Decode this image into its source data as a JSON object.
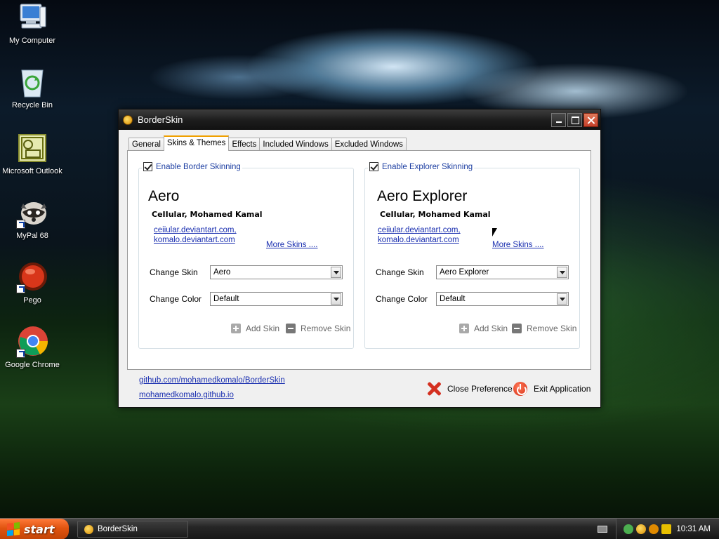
{
  "desktop": {
    "icons": [
      {
        "label": "My Computer"
      },
      {
        "label": "Recycle Bin"
      },
      {
        "label": "Microsoft Outlook"
      },
      {
        "label": "MyPal 68"
      },
      {
        "label": "Pego"
      },
      {
        "label": "Google Chrome"
      }
    ]
  },
  "window": {
    "title": "BorderSkin",
    "tabs": [
      {
        "label": "General",
        "active": false
      },
      {
        "label": "Skins & Themes",
        "active": true
      },
      {
        "label": "Effects",
        "active": false
      },
      {
        "label": "Included Windows",
        "active": false
      },
      {
        "label": "Excluded Windows",
        "active": false
      }
    ],
    "border_group": {
      "checkbox_label": "Enable Border Skinning",
      "checked": true,
      "skin_name": "Aero",
      "author": "CeIIular, Mohamed Kamal",
      "site1": "ceiiular.deviantart.com,",
      "site2": "komalo.deviantart.com",
      "more_link": "More Skins ....",
      "change_skin_label": "Change Skin",
      "change_skin_value": "Aero",
      "change_color_label": "Change Color",
      "change_color_value": "Default",
      "add_label": "Add Skin",
      "remove_label": "Remove Skin"
    },
    "explorer_group": {
      "checkbox_label": "Enable Explorer Skinning",
      "checked": true,
      "skin_name": "Aero Explorer",
      "author": "CeIIular, Mohamed Kamal",
      "site1": "ceiiular.deviantart.com,",
      "site2": "komalo.deviantart.com",
      "more_link": "More Skins ....",
      "change_skin_label": "Change Skin",
      "change_skin_value": "Aero Explorer",
      "change_color_label": "Change Color",
      "change_color_value": "Default",
      "add_label": "Add Skin",
      "remove_label": "Remove Skin"
    },
    "footer": {
      "github_link": "github.com/mohamedkomalo/BorderSkin",
      "site_link": "mohamedkomalo.github.io",
      "close_label": "Close Preference",
      "exit_label": "Exit Application"
    }
  },
  "taskbar": {
    "start_label": "start",
    "task_label": "BorderSkin",
    "clock": "10:31 AM"
  },
  "colors": {
    "link": "#1a2fb0",
    "group_title": "#1a3ca0",
    "active_tab_accent": "#f0a000",
    "start_button": "#e05410"
  }
}
